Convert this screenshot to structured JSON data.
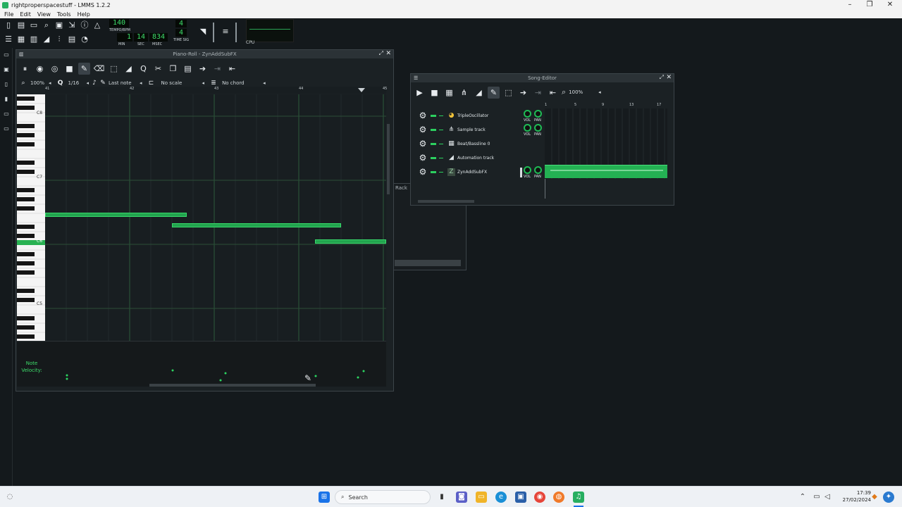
{
  "window": {
    "title": "rightproperspacestuff - LMMS 1.2.2"
  },
  "menu": [
    "File",
    "Edit",
    "View",
    "Tools",
    "Help"
  ],
  "toolbar": {
    "tempo": "140",
    "tempo_label": "TEMPO/BPM",
    "time_min": "1",
    "time_sec": "14",
    "time_msec": "834",
    "min_label": "MIN",
    "sec_label": "SEC",
    "msec_label": "MSEC",
    "timesig_num": "4",
    "timesig_den": "4",
    "timesig_label": "TIME SIG",
    "cpu_label": "CPU"
  },
  "piano_roll": {
    "title": "Piano-Roll - ZynAddSubFX",
    "zoom": "100%",
    "quantize": "1/16",
    "note_length": "Last note",
    "scale": "No scale",
    "chord": "No chord",
    "bars": [
      "41",
      "42",
      "43",
      "44",
      "45"
    ],
    "octave_labels": [
      "C8",
      "C7",
      "C6",
      "C5"
    ],
    "velocity_label": "Note Velocity:"
  },
  "rack_label": "Rack",
  "song_editor": {
    "title": "Song-Editor",
    "zoom": "100%",
    "bars": [
      "1",
      "5",
      "9",
      "13",
      "17"
    ],
    "vol_label": "VOL",
    "pan_label": "PAN",
    "tracks": [
      {
        "name": "TripleOscillator"
      },
      {
        "name": "Sample track"
      },
      {
        "name": "Beat/Bassline 0"
      },
      {
        "name": "Automation track"
      },
      {
        "name": "ZynAddSubFX"
      }
    ]
  },
  "taskbar": {
    "search": "Search",
    "time": "17:39",
    "date": "27/02/2024"
  }
}
